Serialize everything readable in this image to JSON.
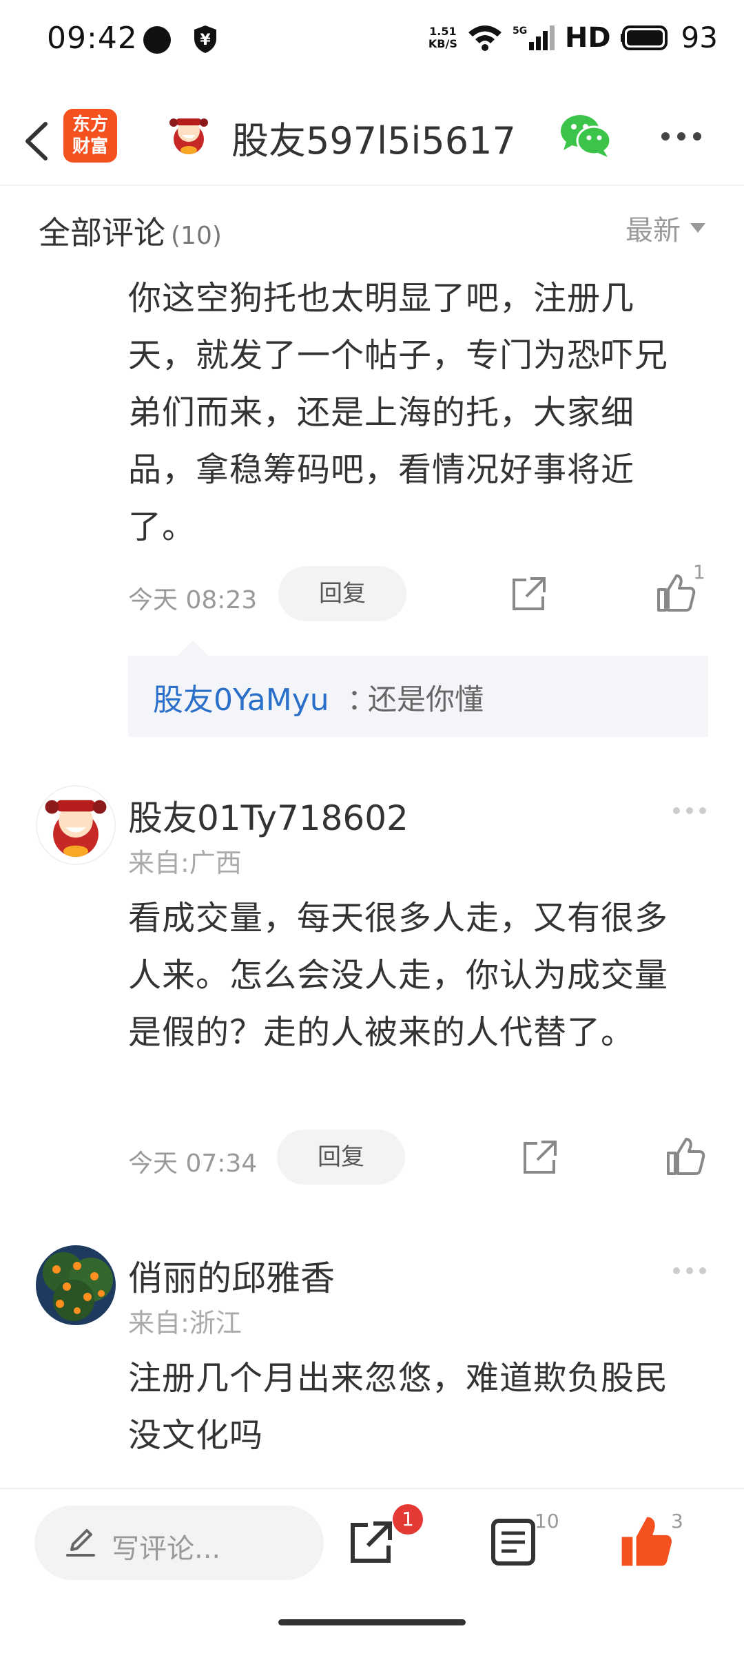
{
  "status_bar": {
    "time": "09:42",
    "net_speed_value": "1.51",
    "net_speed_unit": "KB/S",
    "network": "5G",
    "hd": "HD",
    "battery": "93"
  },
  "header": {
    "logo_line1": "东方",
    "logo_line2": "财富",
    "title": "股友597l5i5617"
  },
  "comments_header": {
    "title": "全部评论",
    "count": "(10)",
    "sort": "最新"
  },
  "comments": [
    {
      "text": "你这空狗托也太明显了吧，注册几天，就发了一个帖子，专门为恐吓兄弟们而来，还是上海的托，大家细品，拿稳筹码吧，看情况好事将近了。",
      "time": "今天 08:23",
      "reply_label": "回复",
      "like_count": "1",
      "reply": {
        "user": "股友0YaMyu",
        "separator": "：",
        "text": "还是你懂"
      }
    },
    {
      "user": "股友01Ty718602",
      "location": "来自:广西",
      "text": "看成交量，每天很多人走，又有很多人来。怎么会没人走，你认为成交量是假的？走的人被来的人代替了。",
      "time": "今天 07:34",
      "reply_label": "回复"
    },
    {
      "user": "俏丽的邱雅香",
      "location": "来自:浙江",
      "text": "注册几个月出来忽悠，难道欺负股民没文化吗"
    }
  ],
  "bottom_bar": {
    "input_placeholder": "写评论...",
    "share_badge": "1",
    "comment_count": "10",
    "like_count": "3"
  },
  "colors": {
    "accent": "#f4511e",
    "link": "#2a6fc9",
    "badge": "#e53935",
    "wechat": "#3cc44a"
  }
}
